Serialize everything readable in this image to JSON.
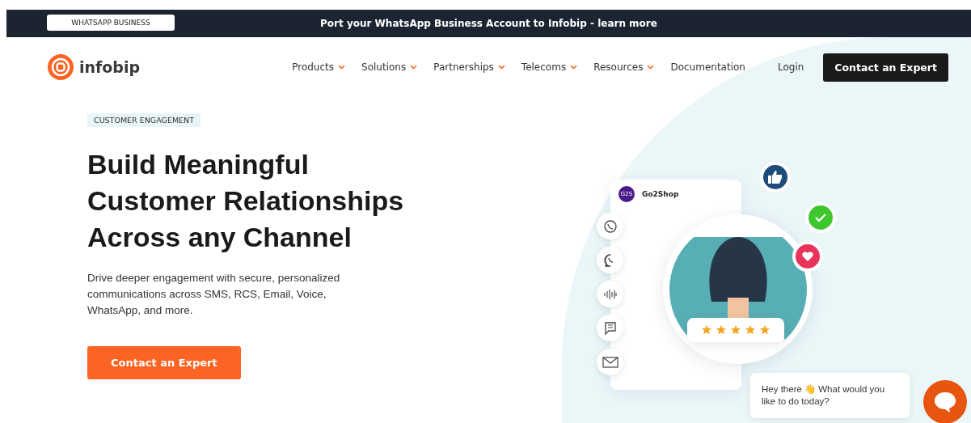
{
  "announcement": {
    "badge": "WHATSAPP BUSINESS",
    "text": "Port your WhatsApp Business Account to Infobip - learn more"
  },
  "brand": "infobip",
  "nav": [
    {
      "label": "Products",
      "dropdown": true
    },
    {
      "label": "Solutions",
      "dropdown": true
    },
    {
      "label": "Partnerships",
      "dropdown": true
    },
    {
      "label": "Telecoms",
      "dropdown": true
    },
    {
      "label": "Resources",
      "dropdown": true
    },
    {
      "label": "Documentation",
      "dropdown": false
    }
  ],
  "login": "Login",
  "nav_cta": "Contact an Expert",
  "hero": {
    "tag": "CUSTOMER ENGAGEMENT",
    "headline": "Build Meaningful Customer Relationships Across any Channel",
    "description": "Drive deeper engagement with secure, personalized communications across SMS, RCS, Email, Voice, WhatsApp, and more.",
    "cta": "Contact an Expert"
  },
  "illustration": {
    "shop_logo": "G2S",
    "shop_name": "Go2Shop",
    "stars": 5
  },
  "chat": {
    "message": "Hey there 👋 What would you like to do today?"
  }
}
